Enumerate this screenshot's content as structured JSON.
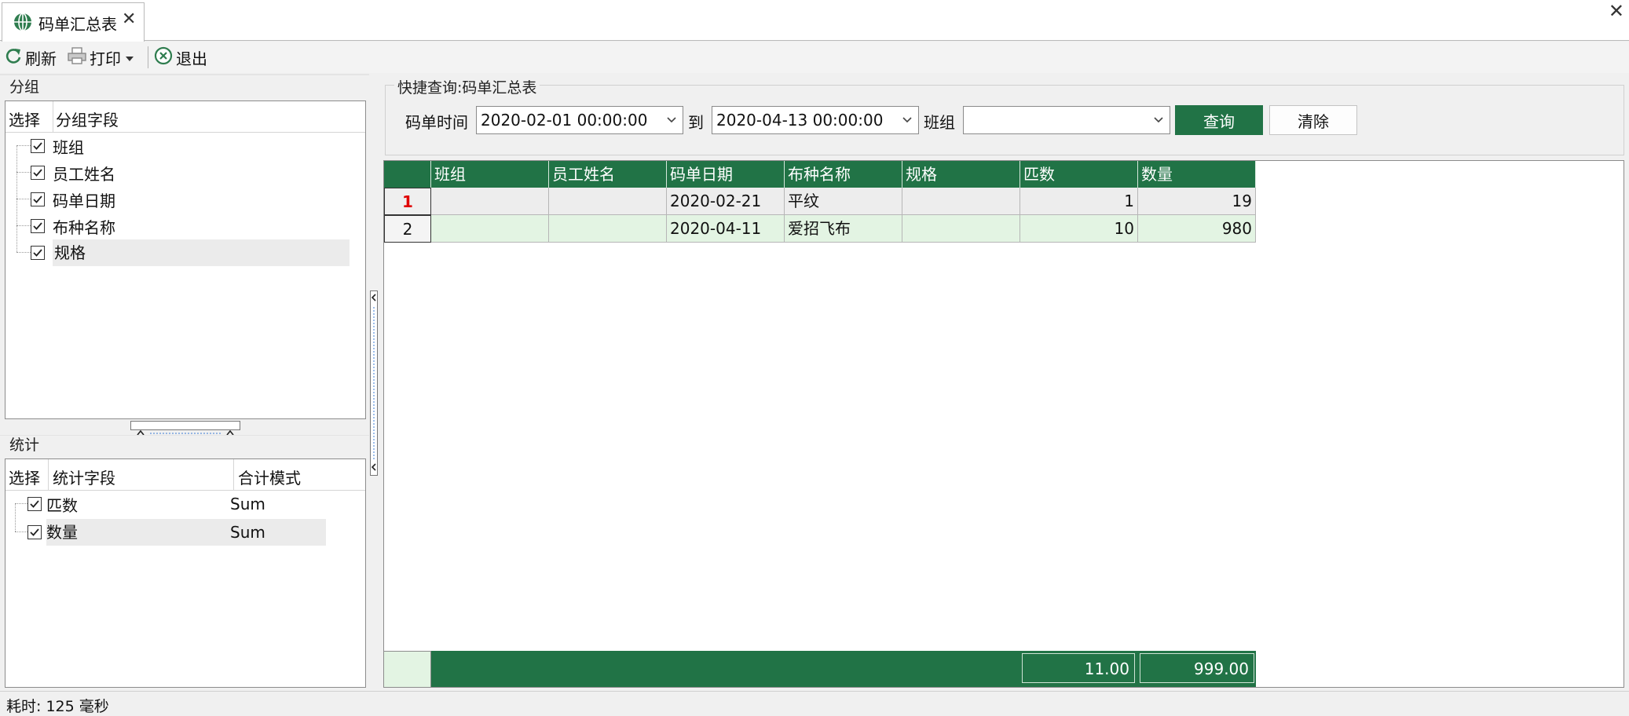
{
  "tab": {
    "title": "码单汇总表",
    "close_glyph": "✕"
  },
  "window": {
    "close_glyph": "✕"
  },
  "toolbar": {
    "refresh_label": "刷新",
    "print_label": "打印",
    "exit_label": "退出"
  },
  "group_panel": {
    "title": "分组",
    "columns": {
      "select": "选择",
      "field": "分组字段"
    },
    "items": [
      {
        "label": "班组",
        "checked": true
      },
      {
        "label": "员工姓名",
        "checked": true
      },
      {
        "label": "码单日期",
        "checked": true
      },
      {
        "label": "布种名称",
        "checked": true
      },
      {
        "label": "规格",
        "checked": true
      }
    ]
  },
  "stats_panel": {
    "title": "统计",
    "columns": {
      "select": "选择",
      "field": "统计字段",
      "mode": "合计模式"
    },
    "items": [
      {
        "label": "匹数",
        "mode": "Sum",
        "checked": true
      },
      {
        "label": "数量",
        "mode": "Sum",
        "checked": true
      }
    ]
  },
  "query": {
    "title": "快捷查询:码单汇总表",
    "time_label": "码单时间",
    "from_value": "2020-02-01 00:00:00",
    "to_label": "到",
    "to_value": "2020-04-13 00:00:00",
    "team_label": "班组",
    "team_value": "",
    "search_button": "查询",
    "clear_button": "清除"
  },
  "grid": {
    "columns": [
      "班组",
      "员工姓名",
      "码单日期",
      "布种名称",
      "规格",
      "匹数",
      "数量"
    ],
    "rows": [
      {
        "no": "1",
        "cells": [
          "",
          "",
          "2020-02-21",
          "平纹",
          "",
          "1",
          "19"
        ]
      },
      {
        "no": "2",
        "cells": [
          "",
          "",
          "2020-04-11",
          "爱招飞布",
          "",
          "10",
          "980"
        ]
      }
    ],
    "footer": {
      "pieces_total": "11.00",
      "qty_total": "999.00"
    }
  },
  "status": {
    "elapsed": "耗时: 125 毫秒"
  },
  "colors": {
    "accent": "#217346",
    "row_alt": "#e3f4e3",
    "row_num_current": "#e00000"
  },
  "icons": [
    "globe-icon",
    "refresh-icon",
    "printer-icon",
    "dropdown-arrow-icon",
    "exit-icon",
    "checkbox-icon",
    "collapse-left-icon",
    "collapse-up-icon"
  ]
}
